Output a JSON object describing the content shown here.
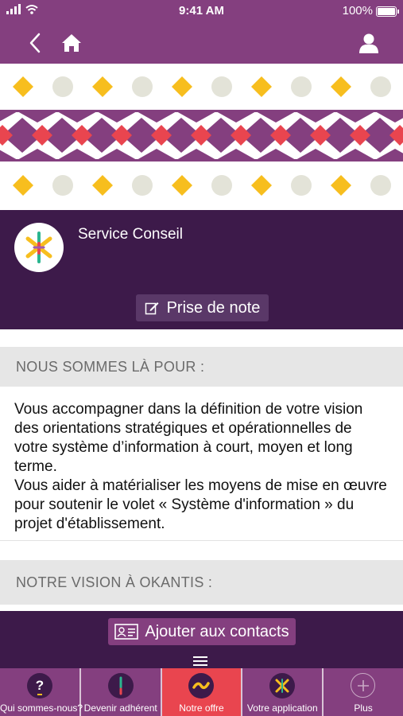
{
  "status_bar": {
    "time": "9:41 AM",
    "battery": "100%"
  },
  "nav": {
    "back_icon": "chevron-left-icon",
    "home_icon": "home-icon",
    "profile_icon": "user-icon"
  },
  "service": {
    "title": "Service Conseil",
    "note_button": "Prise de note"
  },
  "sections": [
    {
      "heading": "NOUS SOMMES LÀ POUR :",
      "paragraphs": [
        "Vous accompagner dans la définition de votre vision des orientations stratégiques et opérationnelles de votre système d’information à court, moyen et long terme.",
        "Vous aider à matérialiser les moyens de mise en œuvre pour soutenir le volet « Système d'information » du projet d'établissement."
      ]
    },
    {
      "heading": "NOTRE VISION À OKANTIS :"
    }
  ],
  "contact_button": "Ajouter aux contacts",
  "tabs": [
    {
      "label": "Qui sommes-nous?",
      "icon": "question-icon"
    },
    {
      "label": "Devenir adhérent",
      "icon": "adherent-icon"
    },
    {
      "label": "Notre offre",
      "icon": "offre-icon",
      "active": true
    },
    {
      "label": "Votre application",
      "icon": "application-icon"
    },
    {
      "label": "Plus",
      "icon": "plus-icon"
    }
  ],
  "colors": {
    "primary": "#843f7f",
    "dark": "#3d1a4a",
    "accent": "#e9454f",
    "yellow": "#f7be1e"
  }
}
